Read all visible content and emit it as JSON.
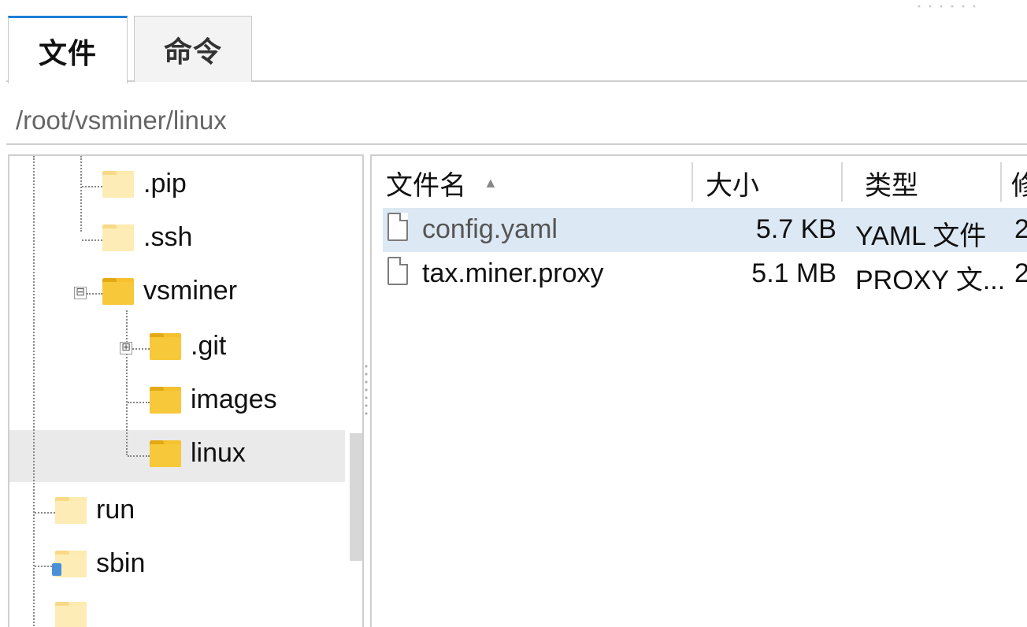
{
  "tabs": [
    {
      "label": "文件",
      "active": true
    },
    {
      "label": "命令",
      "active": false
    }
  ],
  "path": "/root/vsminer/linux",
  "tree": {
    "items": [
      {
        "label": ".pip"
      },
      {
        "label": ".ssh"
      },
      {
        "label": "vsminer",
        "expander": "⊟"
      },
      {
        "label": ".git",
        "expander": "⊞"
      },
      {
        "label": "images"
      },
      {
        "label": "linux",
        "selected": true
      },
      {
        "label": "run"
      },
      {
        "label": "sbin"
      }
    ]
  },
  "list": {
    "columns": {
      "name": "文件名",
      "size": "大小",
      "type": "类型",
      "extra": "修"
    },
    "rows": [
      {
        "name": "config.yaml",
        "size": "5.7 KB",
        "type": "YAML 文件",
        "extra": "2",
        "selected": true
      },
      {
        "name": "tax.miner.proxy",
        "size": "5.1 MB",
        "type": "PROXY 文...",
        "extra": "2"
      }
    ]
  },
  "colors": {
    "active_tab_accent": "#1e7fd6",
    "selected_row": "#dce8f3",
    "folder": "#f5c12f"
  }
}
